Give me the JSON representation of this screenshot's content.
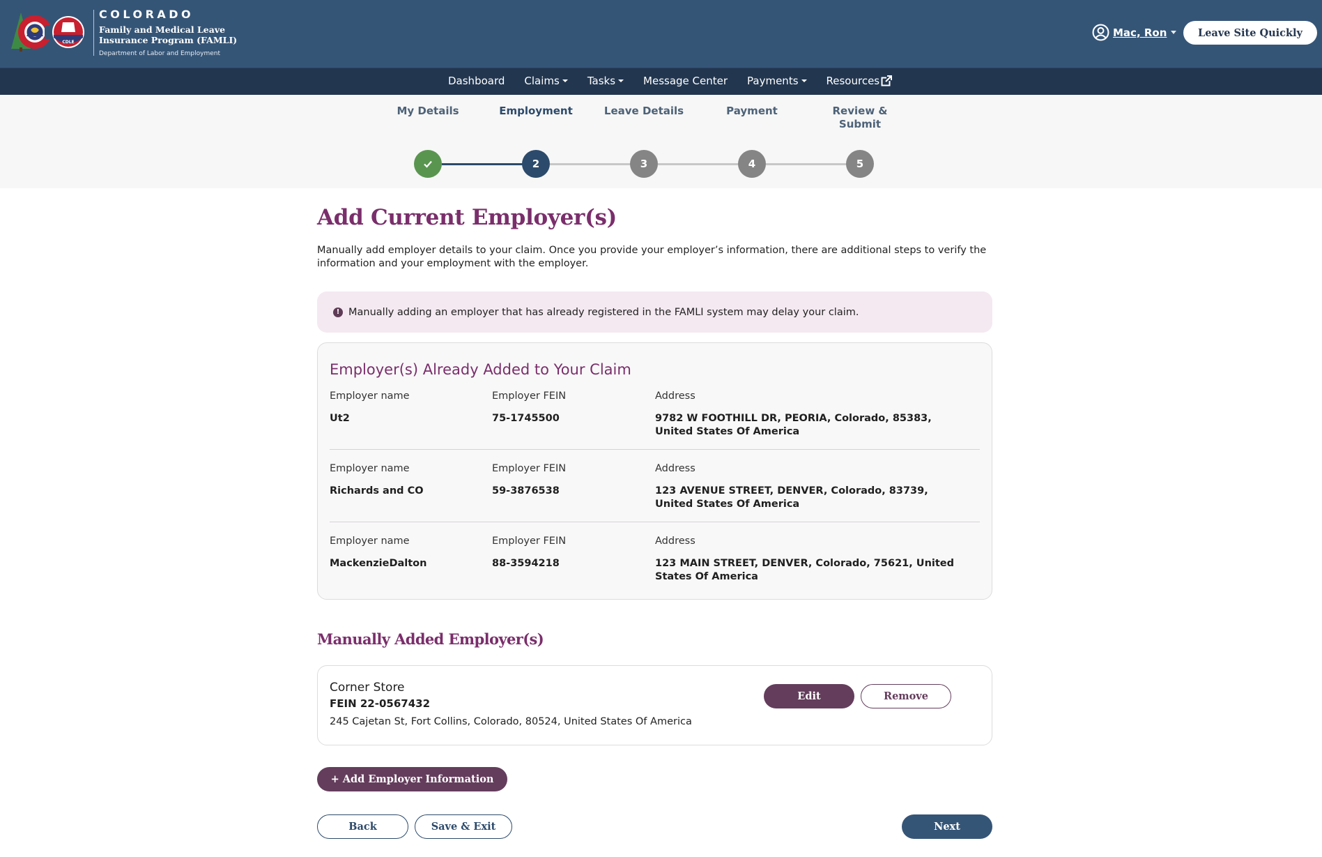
{
  "header": {
    "state": "COLORADO",
    "program_line1": "Family and Medical Leave",
    "program_line2": "Insurance Program (FAMLI)",
    "department": "Department of Labor and Employment",
    "cdle_badge": "CDLE",
    "user_name": "Mac, Ron",
    "leave_site_label": "Leave Site Quickly"
  },
  "nav": {
    "items": [
      {
        "label": "Dashboard",
        "dropdown": false
      },
      {
        "label": "Claims",
        "dropdown": true
      },
      {
        "label": "Tasks",
        "dropdown": true
      },
      {
        "label": "Message Center",
        "dropdown": false
      },
      {
        "label": "Payments",
        "dropdown": true
      },
      {
        "label": "Resources",
        "dropdown": false,
        "external": true
      }
    ]
  },
  "stepper": {
    "current_step": 2,
    "steps": [
      {
        "label": "My Details",
        "number": "1",
        "status": "complete"
      },
      {
        "label": "Employment",
        "number": "2",
        "status": "current"
      },
      {
        "label": "Leave Details",
        "number": "3",
        "status": "upcoming"
      },
      {
        "label": "Payment",
        "number": "4",
        "status": "upcoming"
      },
      {
        "label": "Review & Submit",
        "label_line1": "Review &",
        "label_line2": "Submit",
        "number": "5",
        "status": "upcoming"
      }
    ]
  },
  "main": {
    "title": "Add Current Employer(s)",
    "intro": "Manually add employer details to your claim. Once you provide your employer’s information, there are additional steps to verify the information and your employment with the employer.",
    "alert": {
      "icon": "exclamation-circle-icon",
      "text": "Manually adding an employer that has already registered in the FAMLI system may delay your claim."
    },
    "existing": {
      "title": "Employer(s) Already Added to Your Claim",
      "labels": {
        "name": "Employer name",
        "fein": "Employer FEIN",
        "address": "Address"
      },
      "employers": [
        {
          "name": "Ut2",
          "fein": "75-1745500",
          "address": "9782 W FOOTHILL DR, PEORIA, Colorado, 85383, United States Of America"
        },
        {
          "name": "Richards and CO",
          "fein": "59-3876538",
          "address": "123 AVENUE STREET, DENVER, Colorado, 83739, United States Of America"
        },
        {
          "name": "MackenzieDalton",
          "fein": "88-3594218",
          "address": "123 MAIN STREET, DENVER, Colorado, 75621, United States Of America"
        }
      ]
    },
    "manual": {
      "title": "Manually Added Employer(s)",
      "employers": [
        {
          "name": "Corner Store",
          "fein": "FEIN 22-0567432",
          "address": "245 Cajetan St, Fort Collins, Colorado, 80524, United States Of America",
          "edit_label": "Edit",
          "remove_label": "Remove"
        }
      ]
    },
    "add_label": "+ Add Employer Information",
    "back_label": "Back",
    "save_exit_label": "Save & Exit",
    "next_label": "Next"
  },
  "colors": {
    "header_bg": "#355577",
    "nav_bg": "#22364f",
    "accent_purple": "#7a2e6b",
    "button_purple": "#643d5c",
    "primary_blue": "#2c4a6b",
    "step_complete": "#5a9550",
    "step_upcoming": "#858585",
    "alert_bg": "#f4e9f1"
  }
}
